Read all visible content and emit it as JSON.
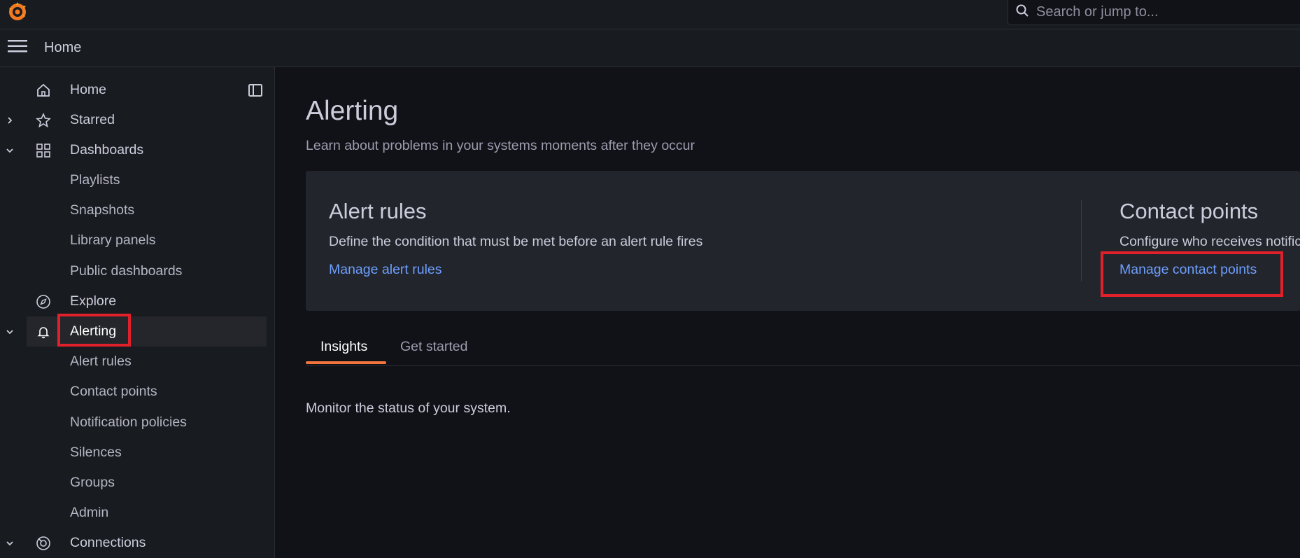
{
  "search": {
    "placeholder": "Search or jump to..."
  },
  "breadcrumb": {
    "current": "Home"
  },
  "sidebar": {
    "items": [
      {
        "label": "Home",
        "icon": "home-icon"
      },
      {
        "label": "Starred",
        "icon": "star-icon",
        "expandable": "collapsed"
      },
      {
        "label": "Dashboards",
        "icon": "dashboards-icon",
        "expandable": "expanded"
      },
      {
        "label": "Playlists"
      },
      {
        "label": "Snapshots"
      },
      {
        "label": "Library panels"
      },
      {
        "label": "Public dashboards"
      },
      {
        "label": "Explore",
        "icon": "compass-icon"
      },
      {
        "label": "Alerting",
        "icon": "bell-icon",
        "expandable": "expanded",
        "active": true
      },
      {
        "label": "Alert rules"
      },
      {
        "label": "Contact points"
      },
      {
        "label": "Notification policies"
      },
      {
        "label": "Silences"
      },
      {
        "label": "Groups"
      },
      {
        "label": "Admin"
      },
      {
        "label": "Connections",
        "icon": "connections-icon",
        "expandable": "expanded"
      }
    ]
  },
  "main": {
    "title": "Alerting",
    "subtitle": "Learn about problems in your systems moments after they occur",
    "cards": [
      {
        "title": "Alert rules",
        "description": "Define the condition that must be met before an alert rule fires",
        "link": "Manage alert rules"
      },
      {
        "title": "Contact points",
        "description": "Configure who receives notifications",
        "link": "Manage contact points"
      }
    ],
    "tabs": [
      {
        "label": "Insights",
        "active": true
      },
      {
        "label": "Get started",
        "active": false
      }
    ],
    "insights_text": "Monitor the status of your system."
  },
  "colors": {
    "accent": "#f28a3e",
    "link": "#6e9fff",
    "highlight": "#e0202a",
    "background": "#111217"
  }
}
